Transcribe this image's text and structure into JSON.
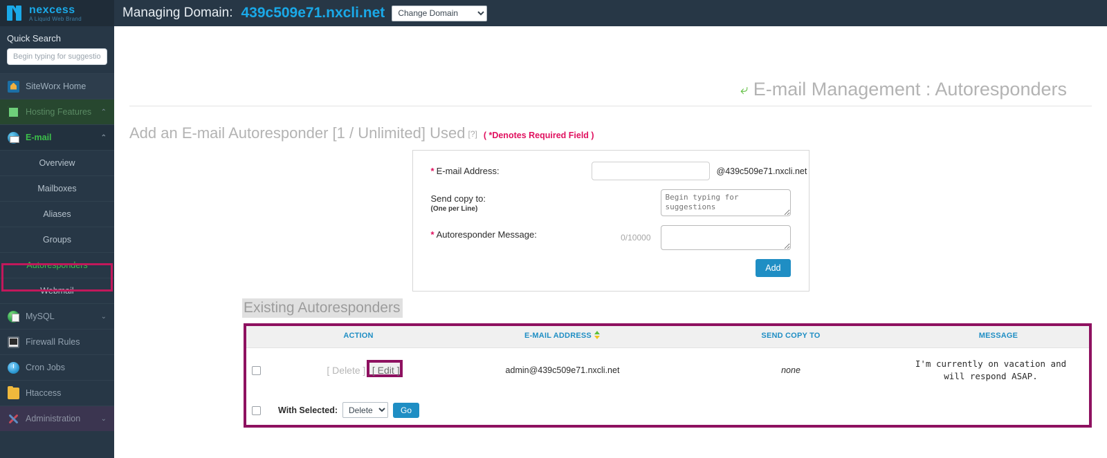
{
  "brand": {
    "name": "nexcess",
    "tagline": "A Liquid Web Brand",
    "logo_color": "#1aa9e8"
  },
  "sidebar": {
    "quick_search_label": "Quick Search",
    "quick_search_placeholder": "Begin typing for suggestions",
    "quick_search_value": "",
    "items": [
      {
        "label": "SiteWorx Home",
        "icon": "home-icon",
        "chevron": ""
      },
      {
        "label": "Hosting Features",
        "icon": "monitor-icon",
        "chevron": "⌃"
      },
      {
        "label": "E-mail",
        "icon": "email-icon",
        "chevron": "⌃"
      },
      {
        "label": "MySQL",
        "icon": "mysql-icon",
        "chevron": "⌄"
      },
      {
        "label": "Firewall Rules",
        "icon": "firewall-icon",
        "chevron": ""
      },
      {
        "label": "Cron Jobs",
        "icon": "clock-icon",
        "chevron": ""
      },
      {
        "label": "Htaccess",
        "icon": "folder-icon",
        "chevron": ""
      },
      {
        "label": "Administration",
        "icon": "tools-icon",
        "chevron": "⌄"
      }
    ],
    "email_subitems": [
      {
        "label": "Overview",
        "active": false
      },
      {
        "label": "Mailboxes",
        "active": false
      },
      {
        "label": "Aliases",
        "active": false
      },
      {
        "label": "Groups",
        "active": false
      },
      {
        "label": "Autoresponders",
        "active": true
      },
      {
        "label": "Webmail",
        "active": false
      }
    ],
    "highlight_color": "#c2185b"
  },
  "topbar": {
    "managing_label": "Managing Domain:",
    "domain": "439c509e71.nxcli.net",
    "change_domain_option": "Change Domain"
  },
  "page": {
    "title": "E-mail Management : Autoresponders",
    "title_arrow_color": "#62c044"
  },
  "add_section": {
    "heading": "Add an E-mail Autoresponder [1 / Unlimited] Used",
    "help_marker": "[?]",
    "required_note": "( *Denotes Required Field )",
    "required_note_color": "#e0115f",
    "fields": {
      "email_label": "E-mail Address:",
      "email_value": "",
      "email_domain_suffix": "@439c509e71.nxcli.net",
      "send_copy_label": "Send copy to:",
      "send_copy_sublabel": "(One per Line)",
      "send_copy_placeholder": "Begin typing for suggestions",
      "send_copy_value": "",
      "message_label": "Autoresponder Message:",
      "message_counter": "0/10000",
      "message_value": ""
    },
    "add_button": "Add",
    "add_button_color": "#1f8ec4"
  },
  "existing_section": {
    "title": "Existing Autoresponders",
    "highlight_color": "#8e1160",
    "columns": [
      "ACTION",
      "E-MAIL ADDRESS",
      "SEND COPY TO",
      "MESSAGE"
    ],
    "sorted_column": "E-MAIL ADDRESS",
    "rows": [
      {
        "delete_label": "[ Delete ]",
        "edit_label": "[ Edit ]",
        "email": "admin@439c509e71.nxcli.net",
        "send_copy_to": "none",
        "message": "I'm currently on vacation and will respond ASAP."
      }
    ],
    "bulk": {
      "with_selected_label": "With Selected:",
      "selected_action": "Delete",
      "go_label": "Go"
    }
  }
}
